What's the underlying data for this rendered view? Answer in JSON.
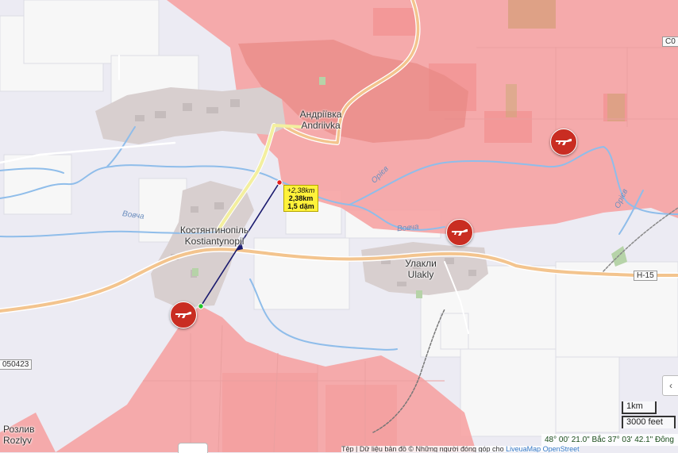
{
  "map": {
    "places": {
      "andriivka_uk": "Андріївка",
      "andriivka_en": "Andriivka",
      "kostiantynopil_uk": "Костянтинопіль",
      "kostiantynopil_en": "Kostiantynopil",
      "ulakly_uk": "Улакли",
      "ulakly_en": "Ulakly",
      "rozlyv_uk": "Розлив",
      "rozlyv_en": "Rozlyv"
    },
    "rivers": {
      "vovcha_1": "Вовча",
      "vovcha_2": "Вовча",
      "oriv_1": "Орієв",
      "oriv_2": "Орієв"
    },
    "roads": {
      "h15": "Н-15",
      "code_left": "050423",
      "code_top_right": "C0"
    },
    "measurement": {
      "line1": "+2,38km",
      "line2": "2,38km",
      "line3": "1,5 dặm"
    },
    "scale": {
      "km": "1km",
      "feet": "3000 feet"
    },
    "coordinates": "48° 00' 21.0\" Bắc 37° 03' 42.1\" Đông",
    "attribution": {
      "text": "Tệp | Dữ liệu bản đồ © Những người đóng góp cho",
      "link": "LiveuaMap OpenStreetMap"
    },
    "markers": [
      "rifle-icon",
      "rifle-icon",
      "rifle-icon"
    ],
    "colors": {
      "occupied_zone": "#f6a3a3",
      "background": "#ecebf3",
      "river": "#8fbdea",
      "main_road": "#f3c48e",
      "marker": "#c92d22",
      "measure_line": "#1a1a6e",
      "label_box": "#fff23a"
    }
  }
}
